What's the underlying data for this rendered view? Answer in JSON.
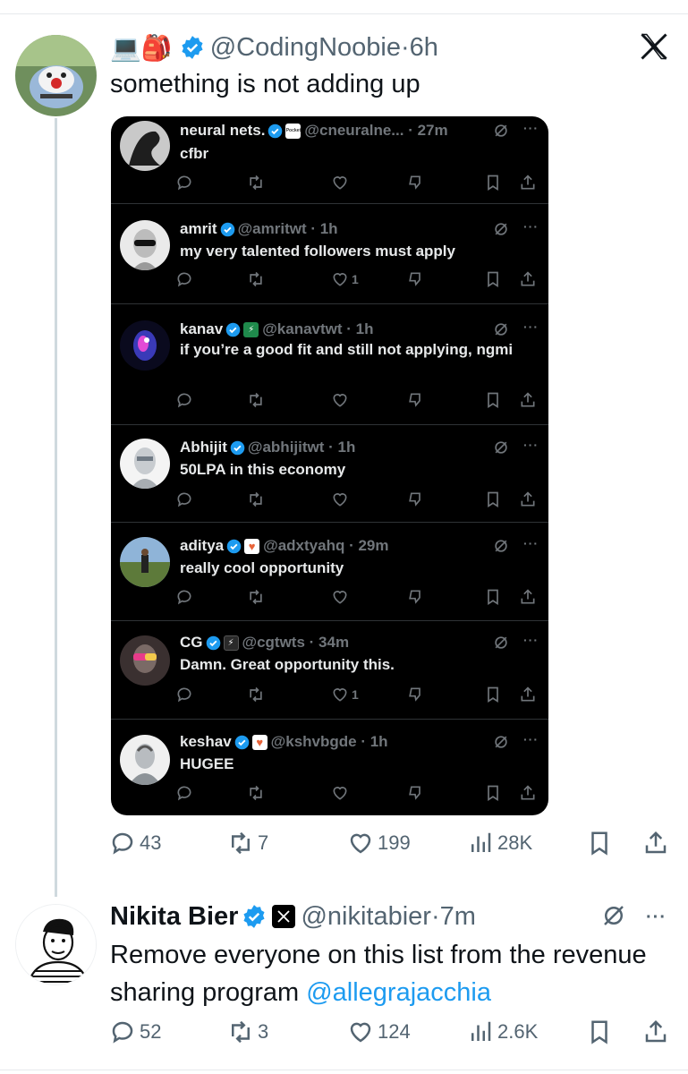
{
  "main_post": {
    "emojis": "💻🎒",
    "handle": "@CodingNoobie",
    "time": "6h",
    "text": "something is not adding up",
    "stats": {
      "replies": "43",
      "reposts": "7",
      "likes": "199",
      "views": "28K"
    }
  },
  "embedded_posts": [
    {
      "name": "neural nets.",
      "badge": "Pocket",
      "handle": "@cneuralne...",
      "time": "27m",
      "text": "cfbr",
      "likes": ""
    },
    {
      "name": "amrit",
      "badge": "",
      "handle": "@amritwt",
      "time": "1h",
      "text": "my very talented followers must apply",
      "likes": "1"
    },
    {
      "name": "kanav",
      "badge": "⚡",
      "handle": "@kanavtwt",
      "time": "1h",
      "text": "if you’re a good fit and still not applying, ngmi",
      "likes": ""
    },
    {
      "name": "Abhijit",
      "badge": "",
      "handle": "@abhijitwt",
      "time": "1h",
      "text": "50LPA in this economy",
      "likes": ""
    },
    {
      "name": "aditya",
      "badge": "♥",
      "handle": "@adxtyahq",
      "time": "29m",
      "text": "really cool opportunity",
      "likes": ""
    },
    {
      "name": "CG",
      "badge": "⚡",
      "handle": "@cgtwts",
      "time": "34m",
      "text": "Damn. Great opportunity this.",
      "likes": "1"
    },
    {
      "name": "keshav",
      "badge": "♥",
      "handle": "@kshvbgde",
      "time": "1h",
      "text": "HUGEE",
      "likes": ""
    }
  ],
  "reply": {
    "name": "Nikita Bier",
    "handle": "@nikitabier",
    "time": "7m",
    "text": "Remove everyone on this list from the revenue sharing program ",
    "mention": "@allegrajacchia",
    "stats": {
      "replies": "52",
      "reposts": "3",
      "likes": "124",
      "views": "2.6K"
    }
  },
  "colors": {
    "verified": "#1d9bf0",
    "mention": "#1d9bf0",
    "muted": "#536471",
    "embed_bg": "#000000"
  },
  "icons": [
    "reply-icon",
    "repost-icon",
    "like-icon",
    "dislike-icon",
    "views-icon",
    "bookmark-icon",
    "share-icon",
    "grok-icon",
    "more-icon",
    "verified-icon",
    "x-logo-icon"
  ]
}
